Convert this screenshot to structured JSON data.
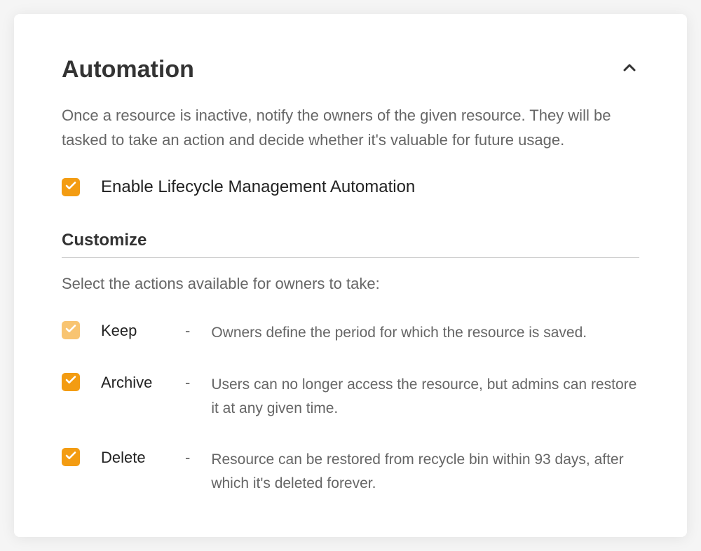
{
  "panel": {
    "title": "Automation",
    "description": "Once a resource is inactive, notify the owners of the given resource. They will be tasked to take an action and decide whether it's valuable for future usage.",
    "enable_label": "Enable Lifecycle Management Automation",
    "customize_heading": "Customize",
    "customize_sub": "Select the actions available for owners to take:",
    "actions": [
      {
        "label": "Keep",
        "desc": "Owners define the period for which the resource is saved.",
        "light": true
      },
      {
        "label": "Archive",
        "desc": "Users can no longer access the resource, but admins can restore it at any given time.",
        "light": false
      },
      {
        "label": "Delete",
        "desc": "Resource can be restored from recycle bin within 93 days, after which it's deleted forever.",
        "light": false
      }
    ]
  }
}
